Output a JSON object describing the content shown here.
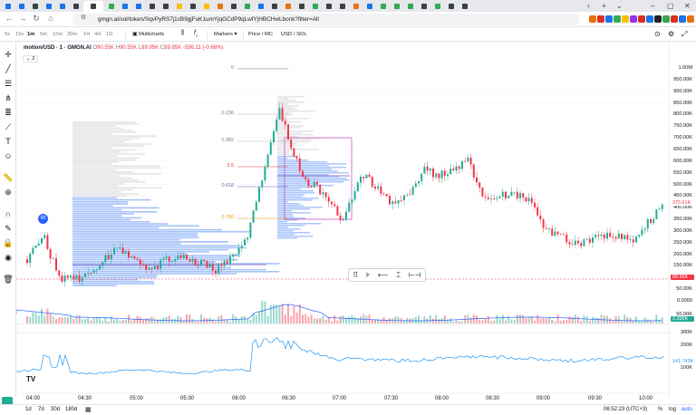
{
  "browser": {
    "url": "gmgn.ai/sol/token/SqvPyRS7j1cB9gjFuK1umYjqGCdP9qLwfYjHBCHwLbonk?filter=All",
    "tab_colors": [
      "#1a73e8",
      "#1a73e8",
      "#3c4043",
      "#1a73e8",
      "#1a73e8",
      "#3c4043",
      "#3c4043",
      "#34a853",
      "#1a73e8",
      "#1a73e8",
      "#3c4043",
      "#3c4043",
      "#fbbc04",
      "#3c4043",
      "#fbbc04",
      "#e8710a",
      "#3c4043",
      "#34a853",
      "#1a73e8",
      "#3c4043",
      "#e8710a",
      "#3c4043",
      "#34a853",
      "#3c4043",
      "#3c4043",
      "#e8710a",
      "#1a73e8",
      "#34a853",
      "#34a853",
      "#34a853",
      "#3c4043",
      "#34a853",
      "#3c4043",
      "#3c4043"
    ],
    "extension_colors": [
      "#e8710a",
      "#d93025",
      "#1a73e8",
      "#34a853",
      "#fbbc04",
      "#9334e6",
      "#d93025",
      "#1a73e8",
      "#202124",
      "#34a853",
      "#d93025",
      "#1a73e8",
      "#e8710a"
    ]
  },
  "toolbar": {
    "intervals": [
      "5s",
      "15s",
      "1m",
      "5m",
      "15m",
      "30m",
      "1H",
      "4H",
      "1D"
    ],
    "active_interval": "1m",
    "multicharts": "Multicharts",
    "fx": "f",
    "markers": "Markers",
    "price_mc": "Price / MC",
    "usd_sol": "USD / SOL"
  },
  "legend": {
    "symbol": "motion/USD · 1 · GMGN.AI",
    "o_label": "O",
    "o": "90.55K",
    "h_label": "H",
    "h": "90.55K",
    "l_label": "L",
    "l": "89.95K",
    "c_label": "C",
    "c": "89.95K",
    "change": "-596.11 (-0.66%)",
    "toggle": "2"
  },
  "price_axis": [
    "1.00M",
    "950.00K",
    "900.00K",
    "850.00K",
    "800.00K",
    "750.00K",
    "700.00K",
    "650.00K",
    "600.00K",
    "550.00K",
    "500.00K",
    "450.00K",
    "400.00K",
    "350.00K",
    "300.00K",
    "250.00K",
    "200.00K",
    "150.00K",
    "100.00K",
    "50.00K",
    "0.0000",
    "50.00K"
  ],
  "price_tags": {
    "high": "375.61K",
    "current": "89.95K",
    "volume": "2.395K",
    "indicator": "141.743K"
  },
  "indicator_axis": [
    "300K",
    "200K",
    "100K"
  ],
  "time_axis": [
    "04:00",
    "04:30",
    "05:00",
    "05:30",
    "06:00",
    "06:30",
    "07:00",
    "07:30",
    "08:00",
    "08:30",
    "09:00",
    "09:30",
    "10:00"
  ],
  "fib_levels": [
    {
      "label": "0",
      "color": "#787b86"
    },
    {
      "label": "0.236",
      "color": "#787b86"
    },
    {
      "label": "0.382",
      "color": "#787b86"
    },
    {
      "label": "0.5",
      "color": "#f23645"
    },
    {
      "label": "0.618",
      "color": "#7e57c2"
    },
    {
      "label": "0.786",
      "color": "#ff9800"
    }
  ],
  "bottom": {
    "ranges": [
      "1d",
      "7d",
      "30d",
      "180d"
    ],
    "time": "06:52:23 (UTC+3)",
    "pct": "%",
    "log": "log",
    "auto": "auto"
  },
  "colors": {
    "up": "#22ab94",
    "down": "#f23645",
    "accent": "#2962ff"
  },
  "badge": "M"
}
